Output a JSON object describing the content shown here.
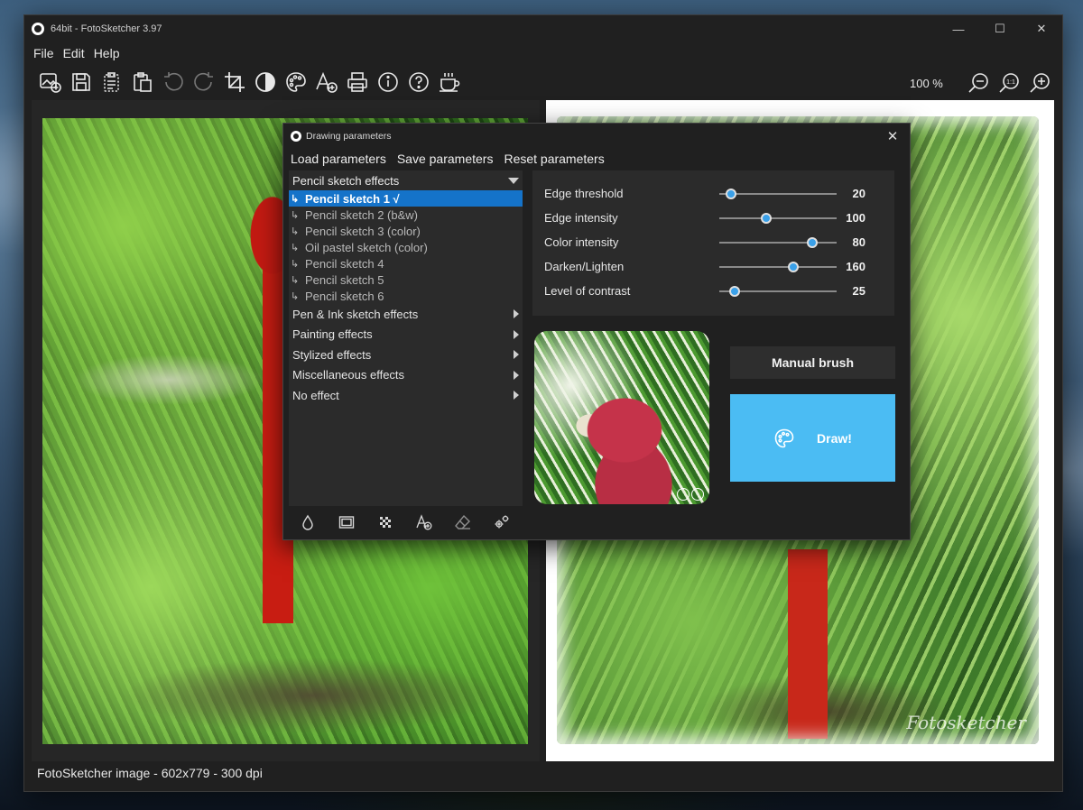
{
  "window": {
    "title": "64bit - FotoSketcher 3.97",
    "controls": {
      "minimize": "—",
      "maximize": "☐",
      "close": "✕"
    }
  },
  "menu": [
    "File",
    "Edit",
    "Help"
  ],
  "toolbar": {
    "icons": [
      "open-image-icon",
      "save-icon",
      "copy-to-clipboard-icon",
      "paste-icon",
      "undo-icon",
      "redo-icon",
      "crop-icon",
      "contrast-icon",
      "palette-icon",
      "add-text-icon",
      "print-icon",
      "info-icon",
      "help-icon",
      "coffee-icon"
    ],
    "zoom_level": "100 %",
    "zoom_icons": [
      "zoom-out-icon",
      "zoom-actual-size-icon",
      "zoom-in-icon"
    ],
    "zoom_actual_label": "1:1"
  },
  "statusbar": {
    "text": "FotoSketcher image - 602x779 - 300 dpi"
  },
  "watermark": "Fotosketcher",
  "dialog": {
    "title": "Drawing parameters",
    "close": "✕",
    "menu": [
      "Load parameters",
      "Save parameters",
      "Reset parameters"
    ],
    "effects": {
      "open_category": "Pencil sketch effects",
      "subitems": [
        {
          "label": "Pencil sketch 1 √",
          "selected": true
        },
        {
          "label": "Pencil sketch 2 (b&w)",
          "selected": false
        },
        {
          "label": "Pencil sketch 3 (color)",
          "selected": false
        },
        {
          "label": "Oil pastel sketch (color)",
          "selected": false
        },
        {
          "label": "Pencil sketch 4",
          "selected": false
        },
        {
          "label": "Pencil sketch 5",
          "selected": false
        },
        {
          "label": "Pencil sketch 6",
          "selected": false
        }
      ],
      "categories": [
        "Pen & Ink sketch effects",
        "Painting effects",
        "Stylized effects",
        "Miscellaneous effects",
        "No effect"
      ],
      "subitem_arrow": "↳"
    },
    "bottom_tools": [
      "droplet-icon",
      "frame-icon",
      "texture-icon",
      "add-text-icon",
      "eraser-icon",
      "settings-gears-icon"
    ],
    "parameters": [
      {
        "label": "Edge threshold",
        "value": "20",
        "fraction": 0.1
      },
      {
        "label": "Edge intensity",
        "value": "100",
        "fraction": 0.4
      },
      {
        "label": "Color intensity",
        "value": "80",
        "fraction": 0.79
      },
      {
        "label": "Darken/Lighten",
        "value": "160",
        "fraction": 0.63
      },
      {
        "label": "Level of contrast",
        "value": "25",
        "fraction": 0.13
      }
    ],
    "preview_zoom_icons": [
      "preview-zoom-out-icon",
      "preview-zoom-in-icon"
    ],
    "manual_brush_label": "Manual brush",
    "draw_label": "Draw!",
    "colors": {
      "accent": "#1573c9",
      "draw_button": "#4bbcf3",
      "slider_thumb": "#3aa0e8"
    }
  }
}
